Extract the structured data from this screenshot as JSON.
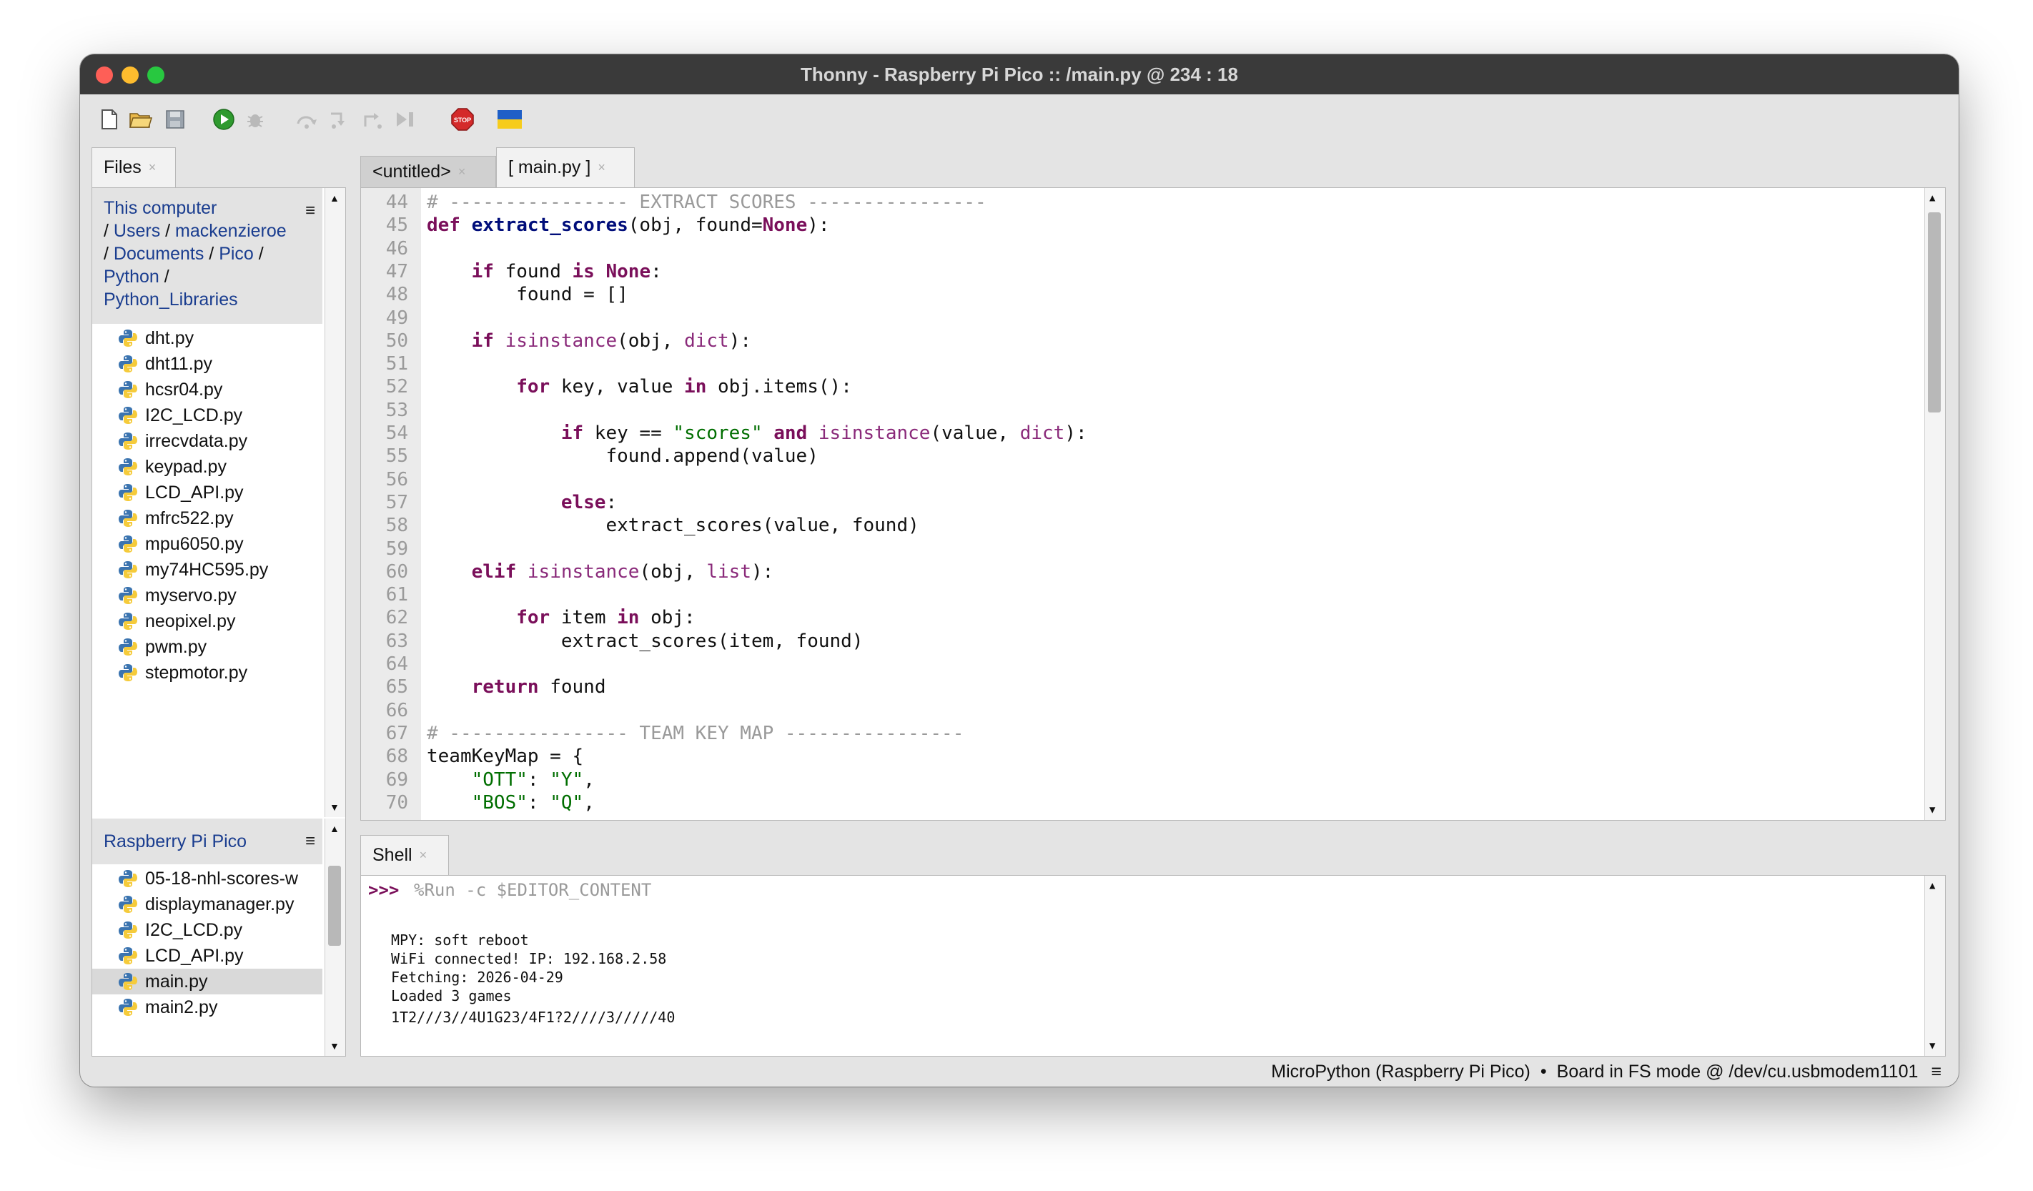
{
  "window": {
    "title": "Thonny  -  Raspberry Pi Pico :: /main.py  @  234 : 18"
  },
  "toolbar": {
    "buttons": [
      "new-file",
      "open-file",
      "save-file",
      "run",
      "debug",
      "step-over",
      "step-into",
      "step-out",
      "resume",
      "stop",
      "ukraine-flag"
    ]
  },
  "files": {
    "tab_label": "Files",
    "computer": {
      "title": "This computer",
      "path": [
        "Users",
        "mackenzieroe",
        "Documents",
        "Pico",
        "Python",
        "Python_Libraries"
      ],
      "items": [
        "dht.py",
        "dht11.py",
        "hcsr04.py",
        "I2C_LCD.py",
        "irrecvdata.py",
        "keypad.py",
        "LCD_API.py",
        "mfrc522.py",
        "mpu6050.py",
        "my74HC595.py",
        "myservo.py",
        "neopixel.py",
        "pwm.py",
        "stepmotor.py"
      ]
    },
    "pico": {
      "title": "Raspberry Pi Pico",
      "items": [
        "05-18-nhl-scores-w",
        "displaymanager.py",
        "I2C_LCD.py",
        "LCD_API.py",
        "main.py",
        "main2.py"
      ],
      "selected": "main.py"
    }
  },
  "editor": {
    "tabs": [
      {
        "label": "<untitled>"
      },
      {
        "label": "[ main.py ]"
      }
    ],
    "lines": [
      {
        "n": "44",
        "html": "<span class=\"cmt\"># ---------------- EXTRACT SCORES ----------------</span>"
      },
      {
        "n": "45",
        "html": "<span class=\"kw\">def</span> <span class=\"fn\">extract_scores</span>(obj, found=<span class=\"kw\">None</span>):"
      },
      {
        "n": "46",
        "html": ""
      },
      {
        "n": "47",
        "html": "    <span class=\"kw\">if</span> found <span class=\"kw\">is</span> <span class=\"kw\">None</span>:"
      },
      {
        "n": "48",
        "html": "        found = []"
      },
      {
        "n": "49",
        "html": ""
      },
      {
        "n": "50",
        "html": "    <span class=\"kw\">if</span> <span class=\"bi\">isinstance</span>(obj, <span class=\"bi\">dict</span>):"
      },
      {
        "n": "51",
        "html": ""
      },
      {
        "n": "52",
        "html": "        <span class=\"kw\">for</span> key, value <span class=\"kw\">in</span> obj.items():"
      },
      {
        "n": "53",
        "html": ""
      },
      {
        "n": "54",
        "html": "            <span class=\"kw\">if</span> key == <span class=\"str\">\"scores\"</span> <span class=\"kw\">and</span> <span class=\"bi\">isinstance</span>(value, <span class=\"bi\">dict</span>):"
      },
      {
        "n": "55",
        "html": "                found.append(value)"
      },
      {
        "n": "56",
        "html": ""
      },
      {
        "n": "57",
        "html": "            <span class=\"kw\">else</span>:"
      },
      {
        "n": "58",
        "html": "                extract_scores(value, found)"
      },
      {
        "n": "59",
        "html": ""
      },
      {
        "n": "60",
        "html": "    <span class=\"kw\">elif</span> <span class=\"bi\">isinstance</span>(obj, <span class=\"bi\">list</span>):"
      },
      {
        "n": "61",
        "html": ""
      },
      {
        "n": "62",
        "html": "        <span class=\"kw\">for</span> item <span class=\"kw\">in</span> obj:"
      },
      {
        "n": "63",
        "html": "            extract_scores(item, found)"
      },
      {
        "n": "64",
        "html": ""
      },
      {
        "n": "65",
        "html": "    <span class=\"kw\">return</span> found"
      },
      {
        "n": "66",
        "html": ""
      },
      {
        "n": "67",
        "html": "<span class=\"cmt\"># ---------------- TEAM KEY MAP ----------------</span>"
      },
      {
        "n": "68",
        "html": "teamKeyMap = {"
      },
      {
        "n": "69",
        "html": "    <span class=\"str\">\"OTT\"</span>: <span class=\"str\">\"Y\"</span>,"
      },
      {
        "n": "70",
        "html": "    <span class=\"str\">\"BOS\"</span>: <span class=\"str\">\"Q\"</span>,"
      }
    ]
  },
  "shell": {
    "tab_label": "Shell",
    "prompt": ">>>",
    "command": "%Run -c $EDITOR_CONTENT",
    "output": [
      "MPY: soft reboot",
      "WiFi connected! IP: 192.168.2.58",
      "Fetching: 2026-04-29",
      "Loaded 3 games",
      "1T2///3//4U1G23/4F1?2////3/////40"
    ]
  },
  "status": {
    "interpreter": "MicroPython (Raspberry Pi Pico)",
    "separator": "•",
    "board": "Board in FS mode @ /dev/cu.usbmodem1101",
    "menu_glyph": "≡"
  },
  "colors": {
    "keyword": "#7a0f5a",
    "function": "#000d7a",
    "string": "#006e00",
    "comment": "#9a9a9a",
    "path_link": "#1a3d8f"
  }
}
